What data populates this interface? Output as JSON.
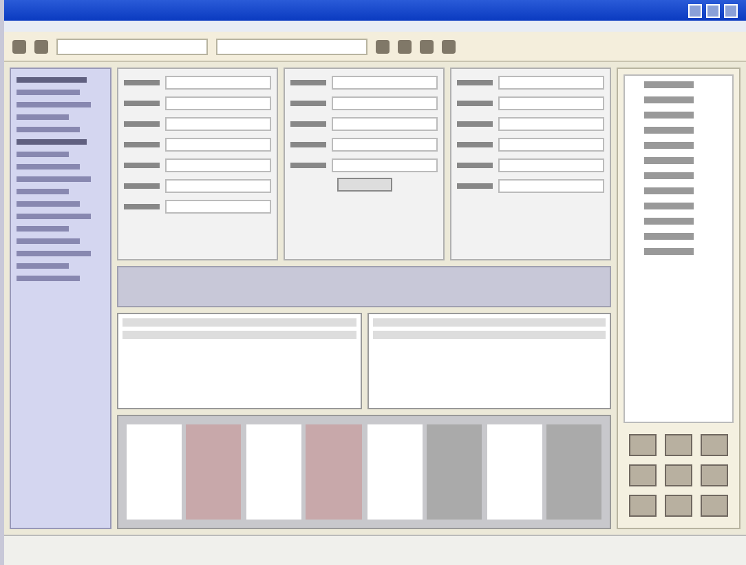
{
  "window": {
    "kind": "xp"
  },
  "toolbar": {
    "buttons": [
      {
        "kind": "icon"
      },
      {
        "kind": "icon"
      },
      {
        "kind": "field"
      },
      {
        "kind": "field"
      },
      {
        "kind": "icon"
      },
      {
        "kind": "icon"
      },
      {
        "kind": "icon"
      },
      {
        "kind": "icon"
      }
    ]
  },
  "sidebar": {
    "items": [
      {
        "kind": "heading"
      },
      {
        "kind": "link"
      },
      {
        "kind": "link"
      },
      {
        "kind": "link"
      },
      {
        "kind": "link"
      },
      {
        "kind": "heading"
      },
      {
        "kind": "link"
      },
      {
        "kind": "link"
      },
      {
        "kind": "link"
      },
      {
        "kind": "link"
      },
      {
        "kind": "link"
      },
      {
        "kind": "link"
      },
      {
        "kind": "link"
      },
      {
        "kind": "link"
      },
      {
        "kind": "link"
      },
      {
        "kind": "link"
      },
      {
        "kind": "link"
      }
    ]
  },
  "form_columns": [
    {
      "rows": [
        {
          "kind": "field"
        },
        {
          "kind": "field"
        },
        {
          "kind": "field"
        },
        {
          "kind": "field"
        },
        {
          "kind": "field"
        },
        {
          "kind": "field"
        },
        {
          "kind": "field"
        }
      ]
    },
    {
      "rows": [
        {
          "kind": "field"
        },
        {
          "kind": "field"
        },
        {
          "kind": "field"
        },
        {
          "kind": "field"
        },
        {
          "kind": "field"
        },
        {
          "kind": "button"
        }
      ]
    },
    {
      "rows": [
        {
          "kind": "field"
        },
        {
          "kind": "field"
        },
        {
          "kind": "field"
        },
        {
          "kind": "field"
        },
        {
          "kind": "field"
        },
        {
          "kind": "field"
        }
      ]
    }
  ],
  "lists": [
    {
      "rows": [
        {
          "kind": "row"
        },
        {
          "kind": "row"
        }
      ]
    },
    {
      "rows": [
        {
          "kind": "row"
        },
        {
          "kind": "row"
        }
      ]
    }
  ],
  "groups": [
    {
      "color": "#c8a8aa"
    },
    {
      "color": "#c8a8aa"
    },
    {
      "color": "#aaaaaa"
    },
    {
      "color": "#aaaaaa"
    }
  ],
  "tree": {
    "items": [
      {
        "kind": "node"
      },
      {
        "kind": "node"
      },
      {
        "kind": "node"
      },
      {
        "kind": "node"
      },
      {
        "kind": "node"
      },
      {
        "kind": "node"
      },
      {
        "kind": "node"
      },
      {
        "kind": "node"
      },
      {
        "kind": "node"
      },
      {
        "kind": "node"
      },
      {
        "kind": "node"
      },
      {
        "kind": "node"
      }
    ]
  },
  "keypad": {
    "keys": [
      {
        "kind": "key"
      },
      {
        "kind": "key"
      },
      {
        "kind": "key"
      },
      {
        "kind": "key"
      },
      {
        "kind": "key"
      },
      {
        "kind": "key"
      },
      {
        "kind": "key"
      },
      {
        "kind": "key"
      },
      {
        "kind": "key"
      }
    ]
  }
}
